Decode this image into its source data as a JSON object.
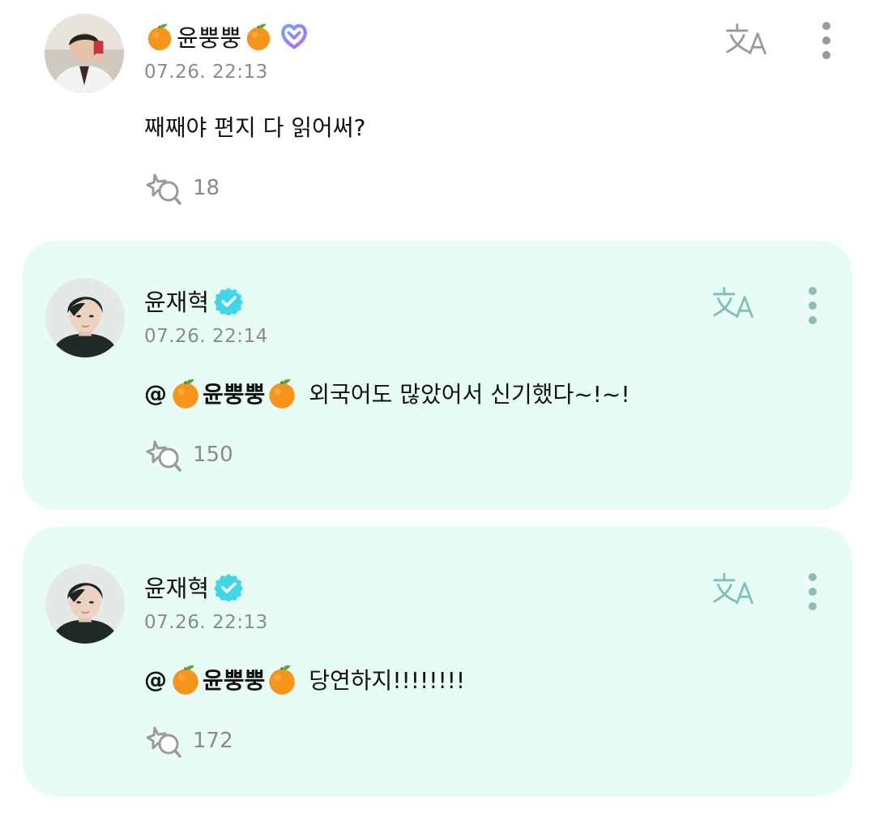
{
  "comments": [
    {
      "author": "윤뿡뿡",
      "badge": "heart-badge-icon",
      "timestamp": "07.26. 22:13",
      "text": "째째야 편지 다 읽어써?",
      "likes": "18"
    },
    {
      "author": "윤재혁",
      "badge": "verified-icon",
      "timestamp": "07.26. 22:14",
      "mention": "@",
      "mention_name": "윤뿡뿡",
      "text": "외국어도 많았어서 신기했다~!~!",
      "likes": "150"
    },
    {
      "author": "윤재혁",
      "badge": "verified-icon",
      "timestamp": "07.26. 22:13",
      "mention": "@",
      "mention_name": "윤뿡뿡",
      "text": "당연하지!!!!!!!!",
      "likes": "172"
    }
  ],
  "colors": {
    "reply_background": "#e8fcf6",
    "verified": "#3fd6e8",
    "timestamp": "#8a8a8a",
    "icon_gray": "#9a9a9a",
    "icon_teal": "#7fbfb8",
    "heart_gradient": [
      "#6aa7ff",
      "#b466ff"
    ]
  }
}
